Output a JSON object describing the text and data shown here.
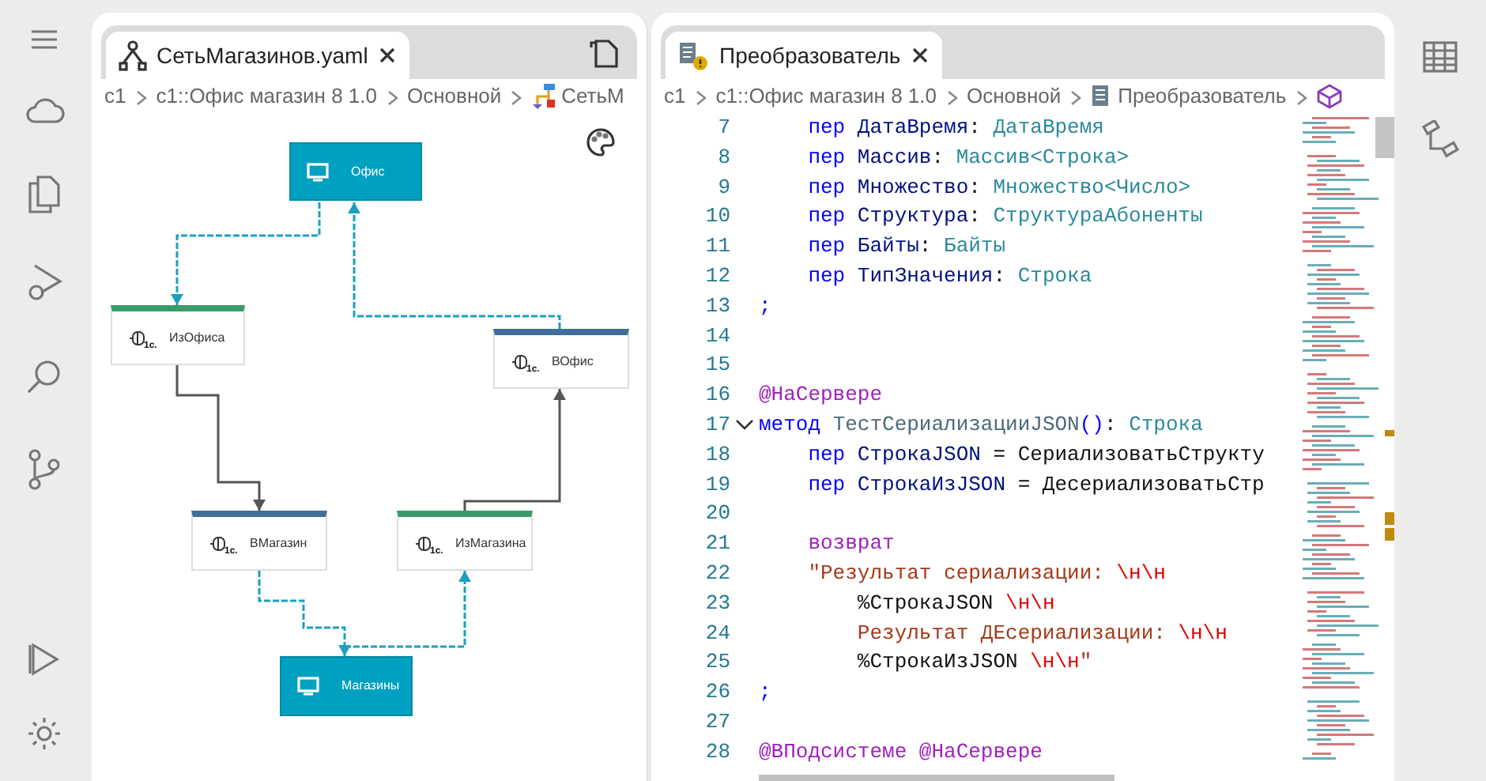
{
  "left_editor": {
    "tab": {
      "label": "СетьМагазинов.yaml",
      "selected": true
    },
    "breadcrumbs": [
      "c1",
      "c1::Офис магазин 8 1.0",
      "Основной",
      "СетьМ"
    ],
    "diagram": {
      "nodes": [
        {
          "kind": "device",
          "label": "Офис"
        },
        {
          "kind": "component",
          "label": "ИзОфиса",
          "logo": "1с.",
          "color": "#3a9a6a"
        },
        {
          "kind": "component",
          "label": "ВОфис",
          "logo": "1с.",
          "color": "#3f6e99"
        },
        {
          "kind": "component",
          "label": "ВМагазин",
          "logo": "1с.",
          "color": "#3f6e99"
        },
        {
          "kind": "component",
          "label": "ИзМагазина",
          "logo": "1с.",
          "color": "#3a9a6a"
        },
        {
          "kind": "device",
          "label": "Магазины"
        }
      ],
      "edges": [
        {
          "kind": "dashed"
        },
        {
          "kind": "dashed"
        },
        {
          "kind": "solid"
        },
        {
          "kind": "solid"
        },
        {
          "kind": "dashed"
        },
        {
          "kind": "dashed"
        }
      ]
    }
  },
  "right_editor": {
    "tab": {
      "label": "Преобразователь",
      "selected": true
    },
    "breadcrumbs": [
      "c1",
      "c1::Офис магазин 8 1.0",
      "Основной",
      "Преобразователь"
    ],
    "lines": [
      {
        "number": "7",
        "tokens": [
          {
            "kind": "kw",
            "text": "    пер"
          },
          {
            "kind": "id",
            "text": " ДатаВремя"
          },
          {
            "kind": "op",
            "text": ": "
          },
          {
            "kind": "type",
            "text": "ДатаВремя"
          }
        ]
      },
      {
        "number": "8",
        "tokens": [
          {
            "kind": "kw",
            "text": "    пер"
          },
          {
            "kind": "id",
            "text": " Массив"
          },
          {
            "kind": "op",
            "text": ": "
          },
          {
            "kind": "type",
            "text": "Массив<Строка>"
          }
        ]
      },
      {
        "number": "9",
        "tokens": [
          {
            "kind": "kw",
            "text": "    пер"
          },
          {
            "kind": "id",
            "text": " Множество"
          },
          {
            "kind": "op",
            "text": ": "
          },
          {
            "kind": "type",
            "text": "Множество<Число>"
          }
        ]
      },
      {
        "number": "10",
        "tokens": [
          {
            "kind": "kw",
            "text": "    пер"
          },
          {
            "kind": "id",
            "text": " Структура"
          },
          {
            "kind": "op",
            "text": ": "
          },
          {
            "kind": "type",
            "text": "СтруктураАбоненты"
          }
        ]
      },
      {
        "number": "11",
        "tokens": [
          {
            "kind": "kw",
            "text": "    пер"
          },
          {
            "kind": "id",
            "text": " Байты"
          },
          {
            "kind": "op",
            "text": ": "
          },
          {
            "kind": "type",
            "text": "Байты"
          }
        ]
      },
      {
        "number": "12",
        "tokens": [
          {
            "kind": "kw",
            "text": "    пер"
          },
          {
            "kind": "id",
            "text": " ТипЗначения"
          },
          {
            "kind": "op",
            "text": ": "
          },
          {
            "kind": "type",
            "text": "Строка"
          }
        ]
      },
      {
        "number": "13",
        "tokens": [
          {
            "kind": "kw",
            "text": ";"
          }
        ]
      },
      {
        "number": "14"
      },
      {
        "number": "15"
      },
      {
        "number": "16",
        "tokens": [
          {
            "kind": "ann",
            "text": "@НаСервере"
          }
        ]
      },
      {
        "number": "17",
        "expanded": true,
        "tokens": [
          {
            "kind": "kw",
            "text": "метод"
          },
          {
            "kind": "fn",
            "text": " ТестСериализацииJSON"
          },
          {
            "kind": "kw",
            "text": "()"
          },
          {
            "kind": "op",
            "text": ": "
          },
          {
            "kind": "type",
            "text": "Строка"
          }
        ]
      },
      {
        "number": "18",
        "tokens": [
          {
            "kind": "kw",
            "text": "    пер"
          },
          {
            "kind": "id",
            "text": " СтрокаJSON"
          },
          {
            "kind": "op",
            "text": " = СериализоватьСтрукту"
          }
        ]
      },
      {
        "number": "19",
        "tokens": [
          {
            "kind": "kw",
            "text": "    пер"
          },
          {
            "kind": "id",
            "text": " СтрокаИзJSON"
          },
          {
            "kind": "op",
            "text": " = ДесериализоватьСтр"
          }
        ]
      },
      {
        "number": "20"
      },
      {
        "number": "21",
        "tokens": [
          {
            "kind": "ann",
            "text": "    возврат"
          }
        ]
      },
      {
        "number": "22",
        "tokens": [
          {
            "kind": "str",
            "text": "    \"Результат сериализации: "
          },
          {
            "kind": "esc",
            "text": "\\н\\н"
          }
        ]
      },
      {
        "number": "23",
        "tokens": [
          {
            "kind": "op",
            "text": "        %СтрокаJSON"
          },
          {
            "kind": "esc",
            "text": " \\н\\н"
          }
        ]
      },
      {
        "number": "24",
        "tokens": [
          {
            "kind": "str",
            "text": "        Результат ДЕсериализации: "
          },
          {
            "kind": "esc",
            "text": "\\н\\н"
          }
        ]
      },
      {
        "number": "25",
        "tokens": [
          {
            "kind": "op",
            "text": "        %СтрокаИзJSON"
          },
          {
            "kind": "esc",
            "text": " \\н\\н"
          },
          {
            "kind": "str",
            "text": "\""
          }
        ]
      },
      {
        "number": "26",
        "tokens": [
          {
            "kind": "kw",
            "text": ";"
          }
        ]
      },
      {
        "number": "27"
      },
      {
        "number": "28",
        "tokens": [
          {
            "kind": "ann",
            "text": "@ВПодсистеме @НаСервере"
          }
        ]
      }
    ]
  }
}
